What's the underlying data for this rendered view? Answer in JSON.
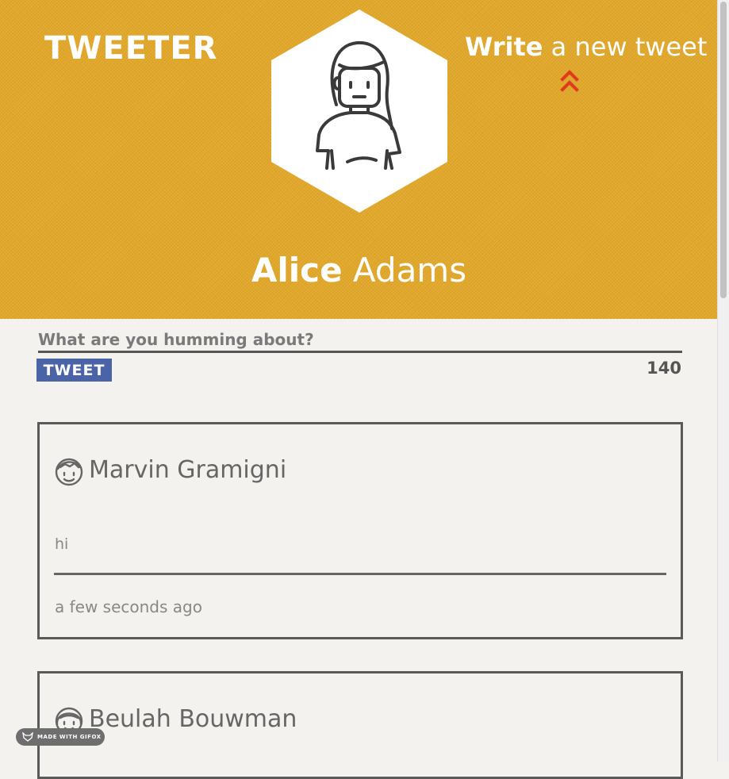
{
  "header": {
    "brand": "TWEETER",
    "write_bold": "Write",
    "write_rest": " a new tweet",
    "profile_first": "Alice",
    "profile_last": " Adams",
    "colors": {
      "background": "#e2a82a",
      "chevron": "#e03a1c"
    }
  },
  "compose": {
    "placeholder": "What are you humming about?",
    "button_label": "TWEET",
    "char_count": "140"
  },
  "tweets": [
    {
      "author": "Marvin Gramigni",
      "text": "hi",
      "timestamp": "a few seconds ago",
      "avatar_icon": "boy-face-icon"
    },
    {
      "author": "Beulah Bouwman",
      "avatar_icon": "girl-face-icon"
    }
  ],
  "badge": {
    "label": "MADE WITH GIFOX"
  }
}
